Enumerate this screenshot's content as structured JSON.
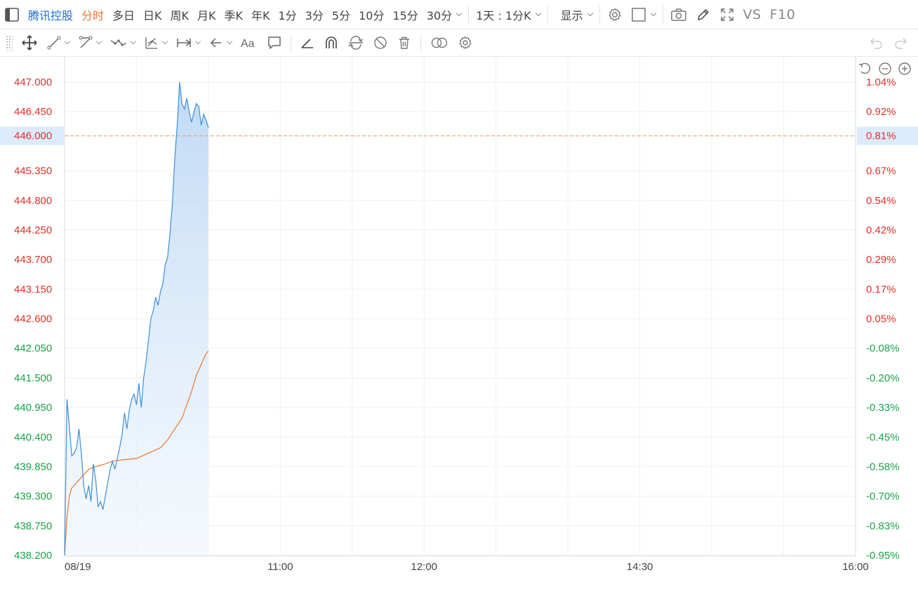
{
  "toolbar": {
    "stock_name": "腾讯控股",
    "periods": [
      "分时",
      "多日",
      "日K",
      "周K",
      "月K",
      "季K",
      "年K",
      "1分",
      "3分",
      "5分",
      "10分",
      "15分",
      "30分"
    ],
    "active_period": "分时",
    "range_select": "1天 : 1分K",
    "display_menu": "显示",
    "vs_label": "VS",
    "f10_label": "F10"
  },
  "colors": {
    "up": "#e0302b",
    "down": "#1aa34a",
    "price_line": "#3d8fd8",
    "avg_line": "#e8772e",
    "highlight_line": "#f2984f",
    "highlight_bg": "#dcebfb",
    "accent_blue": "#1f6fd1",
    "grid": "#eef1f4"
  },
  "chart_data": {
    "type": "line",
    "prev_close": 442.38,
    "ylim": [
      438.2,
      447.0
    ],
    "y_ticks": [
      "447.000",
      "446.450",
      "446.000",
      "445.350",
      "444.800",
      "444.250",
      "443.700",
      "443.150",
      "442.600",
      "442.050",
      "441.500",
      "440.950",
      "440.400",
      "439.850",
      "439.300",
      "438.750",
      "438.200"
    ],
    "y_tick_values": [
      447.0,
      446.45,
      446.0,
      445.35,
      444.8,
      444.25,
      443.7,
      443.15,
      442.6,
      442.05,
      441.5,
      440.95,
      440.4,
      439.85,
      439.3,
      438.75,
      438.2
    ],
    "pct_ticks": [
      "1.04%",
      "0.92%",
      "0.81%",
      "0.67%",
      "0.54%",
      "0.42%",
      "0.29%",
      "0.17%",
      "0.05%",
      "-0.08%",
      "-0.20%",
      "-0.33%",
      "-0.45%",
      "-0.58%",
      "-0.70%",
      "-0.83%",
      "-0.95%"
    ],
    "highlight_price": "446.000",
    "highlight_pct": "0.81%",
    "x_tick_labels": [
      "08/19",
      "11:00",
      "12:00",
      "14:30",
      "16:00"
    ],
    "x_tick_minutes": [
      0,
      90,
      150,
      240,
      330
    ],
    "session_minutes": 330,
    "series": [
      {
        "key": "price",
        "x_minutes": [
          0,
          1,
          2,
          3,
          4,
          5,
          6,
          7,
          8,
          9,
          10,
          11,
          12,
          13,
          14,
          15,
          16,
          17,
          18,
          19,
          20,
          21,
          22,
          23,
          24,
          25,
          26,
          27,
          28,
          29,
          30,
          31,
          32,
          33,
          34,
          35,
          36,
          37,
          38,
          39,
          40,
          41,
          42,
          43,
          44,
          45,
          46,
          47,
          48,
          49,
          50,
          51,
          52,
          53,
          54,
          55,
          56,
          57,
          58,
          59,
          60
        ],
        "values": [
          438.2,
          441.1,
          440.6,
          440.05,
          440.1,
          440.2,
          440.55,
          440.1,
          439.5,
          439.25,
          439.5,
          439.2,
          439.9,
          439.6,
          439.1,
          439.2,
          439.05,
          439.3,
          439.55,
          439.8,
          439.95,
          439.8,
          440.0,
          440.2,
          440.45,
          440.85,
          440.55,
          440.9,
          441.1,
          441.2,
          441.0,
          441.4,
          440.95,
          441.5,
          441.8,
          442.2,
          442.6,
          442.75,
          443.0,
          442.85,
          443.1,
          443.25,
          443.6,
          443.75,
          444.2,
          444.75,
          445.6,
          446.2,
          447.0,
          446.6,
          446.5,
          446.7,
          446.45,
          446.25,
          446.45,
          446.6,
          446.55,
          446.2,
          446.4,
          446.3,
          446.15
        ],
        "x_sampling_note": ""
      },
      {
        "key": "average",
        "x_minutes": [
          0,
          1,
          2,
          3,
          5,
          7,
          10,
          13,
          17,
          20,
          25,
          30,
          35,
          40,
          43,
          46,
          49,
          51,
          53,
          55,
          57,
          58,
          59,
          60
        ],
        "values": [
          438.2,
          438.9,
          439.3,
          439.45,
          439.55,
          439.65,
          439.8,
          439.85,
          439.9,
          439.95,
          439.98,
          440.0,
          440.1,
          440.2,
          440.35,
          440.55,
          440.75,
          441.0,
          441.25,
          441.55,
          441.75,
          441.85,
          441.95,
          442.0
        ]
      }
    ]
  }
}
